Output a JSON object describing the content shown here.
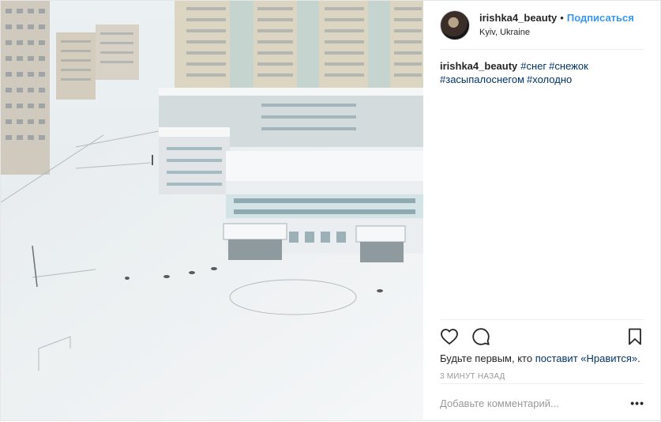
{
  "post": {
    "username": "irishka4_beauty",
    "separator": "•",
    "follow_label": "Подписаться",
    "location": "Kyiv, Ukraine"
  },
  "caption": {
    "username": "irishka4_beauty",
    "hashtags": [
      "#снег",
      "#снежок",
      "#засыпалоснегом",
      "#холодно"
    ]
  },
  "icons": {
    "like": "heart-outline-icon",
    "comment": "speech-bubble-icon",
    "save": "bookmark-icon",
    "more": "ellipsis-icon"
  },
  "likes": {
    "prefix": "Будьте первым, кто",
    "link": "поставит «Нравится»",
    "suffix": "."
  },
  "timestamp": "3 МИНУТ НАЗАД",
  "comment": {
    "placeholder": "Добавьте комментарий...",
    "more_label": "•••"
  },
  "colors": {
    "link_blue": "#3897f0",
    "hashtag": "#003569",
    "muted": "#999999"
  }
}
